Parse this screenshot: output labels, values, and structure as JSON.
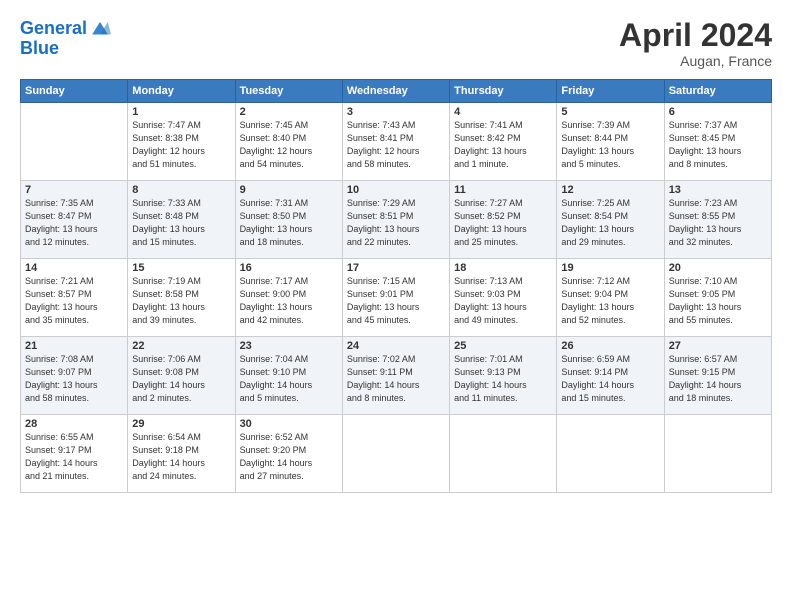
{
  "header": {
    "logo_line1": "General",
    "logo_line2": "Blue",
    "month_title": "April 2024",
    "location": "Augan, France"
  },
  "weekdays": [
    "Sunday",
    "Monday",
    "Tuesday",
    "Wednesday",
    "Thursday",
    "Friday",
    "Saturday"
  ],
  "weeks": [
    [
      {
        "day": "",
        "info": ""
      },
      {
        "day": "1",
        "info": "Sunrise: 7:47 AM\nSunset: 8:38 PM\nDaylight: 12 hours\nand 51 minutes."
      },
      {
        "day": "2",
        "info": "Sunrise: 7:45 AM\nSunset: 8:40 PM\nDaylight: 12 hours\nand 54 minutes."
      },
      {
        "day": "3",
        "info": "Sunrise: 7:43 AM\nSunset: 8:41 PM\nDaylight: 12 hours\nand 58 minutes."
      },
      {
        "day": "4",
        "info": "Sunrise: 7:41 AM\nSunset: 8:42 PM\nDaylight: 13 hours\nand 1 minute."
      },
      {
        "day": "5",
        "info": "Sunrise: 7:39 AM\nSunset: 8:44 PM\nDaylight: 13 hours\nand 5 minutes."
      },
      {
        "day": "6",
        "info": "Sunrise: 7:37 AM\nSunset: 8:45 PM\nDaylight: 13 hours\nand 8 minutes."
      }
    ],
    [
      {
        "day": "7",
        "info": "Sunrise: 7:35 AM\nSunset: 8:47 PM\nDaylight: 13 hours\nand 12 minutes."
      },
      {
        "day": "8",
        "info": "Sunrise: 7:33 AM\nSunset: 8:48 PM\nDaylight: 13 hours\nand 15 minutes."
      },
      {
        "day": "9",
        "info": "Sunrise: 7:31 AM\nSunset: 8:50 PM\nDaylight: 13 hours\nand 18 minutes."
      },
      {
        "day": "10",
        "info": "Sunrise: 7:29 AM\nSunset: 8:51 PM\nDaylight: 13 hours\nand 22 minutes."
      },
      {
        "day": "11",
        "info": "Sunrise: 7:27 AM\nSunset: 8:52 PM\nDaylight: 13 hours\nand 25 minutes."
      },
      {
        "day": "12",
        "info": "Sunrise: 7:25 AM\nSunset: 8:54 PM\nDaylight: 13 hours\nand 29 minutes."
      },
      {
        "day": "13",
        "info": "Sunrise: 7:23 AM\nSunset: 8:55 PM\nDaylight: 13 hours\nand 32 minutes."
      }
    ],
    [
      {
        "day": "14",
        "info": "Sunrise: 7:21 AM\nSunset: 8:57 PM\nDaylight: 13 hours\nand 35 minutes."
      },
      {
        "day": "15",
        "info": "Sunrise: 7:19 AM\nSunset: 8:58 PM\nDaylight: 13 hours\nand 39 minutes."
      },
      {
        "day": "16",
        "info": "Sunrise: 7:17 AM\nSunset: 9:00 PM\nDaylight: 13 hours\nand 42 minutes."
      },
      {
        "day": "17",
        "info": "Sunrise: 7:15 AM\nSunset: 9:01 PM\nDaylight: 13 hours\nand 45 minutes."
      },
      {
        "day": "18",
        "info": "Sunrise: 7:13 AM\nSunset: 9:03 PM\nDaylight: 13 hours\nand 49 minutes."
      },
      {
        "day": "19",
        "info": "Sunrise: 7:12 AM\nSunset: 9:04 PM\nDaylight: 13 hours\nand 52 minutes."
      },
      {
        "day": "20",
        "info": "Sunrise: 7:10 AM\nSunset: 9:05 PM\nDaylight: 13 hours\nand 55 minutes."
      }
    ],
    [
      {
        "day": "21",
        "info": "Sunrise: 7:08 AM\nSunset: 9:07 PM\nDaylight: 13 hours\nand 58 minutes."
      },
      {
        "day": "22",
        "info": "Sunrise: 7:06 AM\nSunset: 9:08 PM\nDaylight: 14 hours\nand 2 minutes."
      },
      {
        "day": "23",
        "info": "Sunrise: 7:04 AM\nSunset: 9:10 PM\nDaylight: 14 hours\nand 5 minutes."
      },
      {
        "day": "24",
        "info": "Sunrise: 7:02 AM\nSunset: 9:11 PM\nDaylight: 14 hours\nand 8 minutes."
      },
      {
        "day": "25",
        "info": "Sunrise: 7:01 AM\nSunset: 9:13 PM\nDaylight: 14 hours\nand 11 minutes."
      },
      {
        "day": "26",
        "info": "Sunrise: 6:59 AM\nSunset: 9:14 PM\nDaylight: 14 hours\nand 15 minutes."
      },
      {
        "day": "27",
        "info": "Sunrise: 6:57 AM\nSunset: 9:15 PM\nDaylight: 14 hours\nand 18 minutes."
      }
    ],
    [
      {
        "day": "28",
        "info": "Sunrise: 6:55 AM\nSunset: 9:17 PM\nDaylight: 14 hours\nand 21 minutes."
      },
      {
        "day": "29",
        "info": "Sunrise: 6:54 AM\nSunset: 9:18 PM\nDaylight: 14 hours\nand 24 minutes."
      },
      {
        "day": "30",
        "info": "Sunrise: 6:52 AM\nSunset: 9:20 PM\nDaylight: 14 hours\nand 27 minutes."
      },
      {
        "day": "",
        "info": ""
      },
      {
        "day": "",
        "info": ""
      },
      {
        "day": "",
        "info": ""
      },
      {
        "day": "",
        "info": ""
      }
    ]
  ]
}
